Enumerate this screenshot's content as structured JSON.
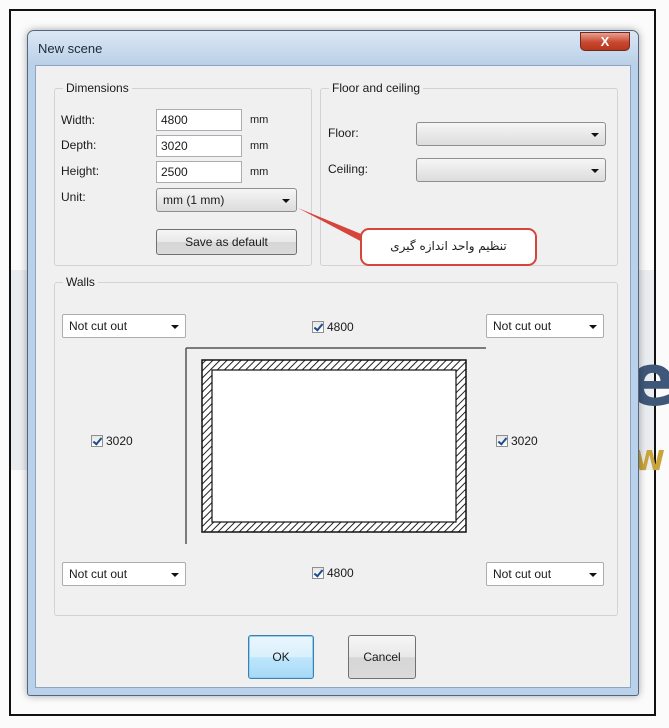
{
  "window": {
    "title": "New scene",
    "close_label": "X"
  },
  "dimensions": {
    "group_label": "Dimensions",
    "width_label": "Width:",
    "width_value": "4800",
    "depth_label": "Depth:",
    "depth_value": "3020",
    "height_label": "Height:",
    "height_value": "2500",
    "unit_suffix": "mm",
    "unit_label": "Unit:",
    "unit_value": "mm (1 mm)",
    "save_default_label": "Save as default"
  },
  "floor_ceiling": {
    "group_label": "Floor and ceiling",
    "floor_label": "Floor:",
    "floor_value": "",
    "ceiling_label": "Ceiling:",
    "ceiling_value": ""
  },
  "annotation": {
    "text": "تنظیم واحد اندازه گیری"
  },
  "walls": {
    "group_label": "Walls",
    "corner_option": "Not cut out",
    "top_length": "4800",
    "bottom_length": "4800",
    "left_length": "3020",
    "right_length": "3020"
  },
  "buttons": {
    "ok_label": "OK",
    "cancel_label": "Cancel"
  },
  "background": {
    "letter_c": "e",
    "letter_w": "W"
  }
}
